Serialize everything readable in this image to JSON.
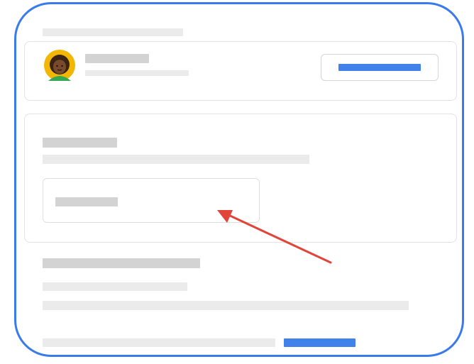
{
  "frame": {
    "border_color": "#3a7bec"
  },
  "colors": {
    "placeholder_light": "#ebebeb",
    "placeholder_mid": "#d3d3d3",
    "accent_blue": "#4182ea",
    "annotation_red": "#e0443a"
  },
  "header": {
    "avatar_icon": "avatar-icon",
    "action_button_icon": "placeholder-bar"
  },
  "annotation": {
    "icon": "arrow-icon",
    "points_to": "inner-field"
  }
}
